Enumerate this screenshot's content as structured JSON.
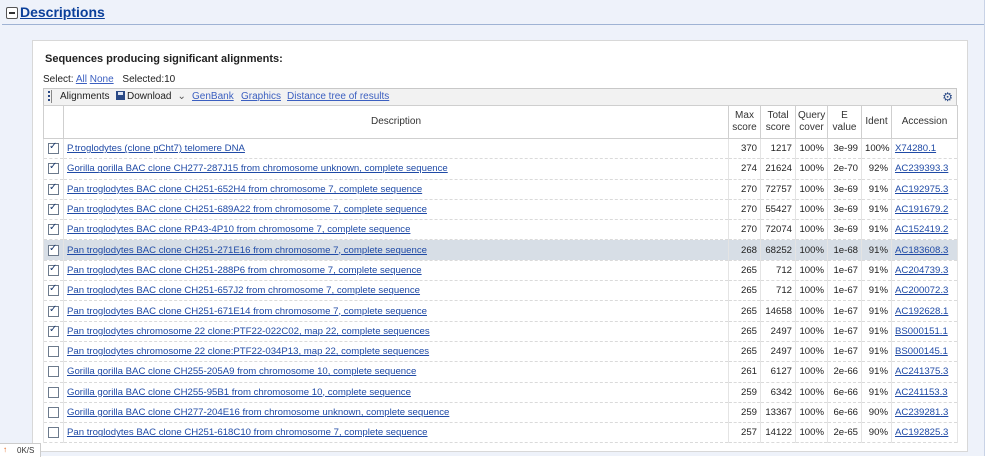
{
  "section": {
    "title": "Descriptions"
  },
  "panel": {
    "heading": "Sequences producing significant alignments:",
    "select": {
      "label": "Select:",
      "all": "All",
      "none": "None",
      "selected": "Selected:10"
    }
  },
  "toolbar": {
    "alignments": "Alignments",
    "download": "Download",
    "genbank": "GenBank",
    "graphics": "Graphics",
    "distance_tree": "Distance tree of results"
  },
  "table": {
    "headers": {
      "description": "Description",
      "max_score": "Max score",
      "total_score": "Total score",
      "query_cover": "Query cover",
      "e_value": "E value",
      "ident": "Ident",
      "accession": "Accession"
    },
    "rows": [
      {
        "checked": true,
        "highlight": false,
        "description": "P.troglodytes (clone pCht7) telomere DNA",
        "max": "370",
        "total": "1217",
        "cover": "100%",
        "e": "3e-99",
        "ident": "100%",
        "acc": "X74280.1"
      },
      {
        "checked": true,
        "highlight": false,
        "description": "Gorilla gorilla BAC clone CH277-287J15 from chromosome unknown, complete sequence",
        "max": "274",
        "total": "21624",
        "cover": "100%",
        "e": "2e-70",
        "ident": "92%",
        "acc": "AC239393.3"
      },
      {
        "checked": true,
        "highlight": false,
        "description": "Pan troglodytes BAC clone CH251-652H4 from chromosome 7, complete sequence",
        "max": "270",
        "total": "72757",
        "cover": "100%",
        "e": "3e-69",
        "ident": "91%",
        "acc": "AC192975.3"
      },
      {
        "checked": true,
        "highlight": false,
        "description": "Pan troglodytes BAC clone CH251-689A22 from chromosome 7, complete sequence",
        "max": "270",
        "total": "55427",
        "cover": "100%",
        "e": "3e-69",
        "ident": "91%",
        "acc": "AC191679.2"
      },
      {
        "checked": true,
        "highlight": false,
        "description": "Pan troglodytes BAC clone RP43-4P10 from chromosome 7, complete sequence",
        "max": "270",
        "total": "72074",
        "cover": "100%",
        "e": "3e-69",
        "ident": "91%",
        "acc": "AC152419.2"
      },
      {
        "checked": true,
        "highlight": true,
        "description": "Pan troglodytes BAC clone CH251-271E16 from chromosome 7, complete sequence",
        "max": "268",
        "total": "68252",
        "cover": "100%",
        "e": "1e-68",
        "ident": "91%",
        "acc": "AC183608.3"
      },
      {
        "checked": true,
        "highlight": false,
        "description": "Pan troglodytes BAC clone CH251-288P6 from chromosome 7, complete sequence",
        "max": "265",
        "total": "712",
        "cover": "100%",
        "e": "1e-67",
        "ident": "91%",
        "acc": "AC204739.3"
      },
      {
        "checked": true,
        "highlight": false,
        "description": "Pan troglodytes BAC clone CH251-657J2 from chromosome 7, complete sequence",
        "max": "265",
        "total": "712",
        "cover": "100%",
        "e": "1e-67",
        "ident": "91%",
        "acc": "AC200072.3"
      },
      {
        "checked": true,
        "highlight": false,
        "description": "Pan troglodytes BAC clone CH251-671E14 from chromosome 7, complete sequence",
        "max": "265",
        "total": "14658",
        "cover": "100%",
        "e": "1e-67",
        "ident": "91%",
        "acc": "AC192628.1"
      },
      {
        "checked": true,
        "highlight": false,
        "description": "Pan troglodytes chromosome 22 clone:PTF22-022C02, map 22, complete sequences",
        "max": "265",
        "total": "2497",
        "cover": "100%",
        "e": "1e-67",
        "ident": "91%",
        "acc": "BS000151.1"
      },
      {
        "checked": false,
        "highlight": false,
        "description": "Pan troglodytes chromosome 22 clone:PTF22-034P13, map 22, complete sequences",
        "max": "265",
        "total": "2497",
        "cover": "100%",
        "e": "1e-67",
        "ident": "91%",
        "acc": "BS000145.1"
      },
      {
        "checked": false,
        "highlight": false,
        "description": "Gorilla gorilla BAC clone CH255-205A9 from chromosome 10, complete sequence",
        "max": "261",
        "total": "6127",
        "cover": "100%",
        "e": "2e-66",
        "ident": "91%",
        "acc": "AC241375.3"
      },
      {
        "checked": false,
        "highlight": false,
        "description": "Gorilla gorilla BAC clone CH255-95B1 from chromosome 10, complete sequence",
        "max": "259",
        "total": "6342",
        "cover": "100%",
        "e": "6e-66",
        "ident": "91%",
        "acc": "AC241153.3"
      },
      {
        "checked": false,
        "highlight": false,
        "description": "Gorilla gorilla BAC clone CH277-204E16 from chromosome unknown, complete sequence",
        "max": "259",
        "total": "13367",
        "cover": "100%",
        "e": "6e-66",
        "ident": "90%",
        "acc": "AC239281.3"
      },
      {
        "checked": false,
        "highlight": false,
        "description": "Pan troglodytes BAC clone CH251-618C10 from chromosome 7, complete sequence",
        "max": "257",
        "total": "14122",
        "cover": "100%",
        "e": "2e-65",
        "ident": "90%",
        "acc": "AC192825.3"
      }
    ]
  },
  "statusbar": {
    "speed": "0K/S"
  }
}
